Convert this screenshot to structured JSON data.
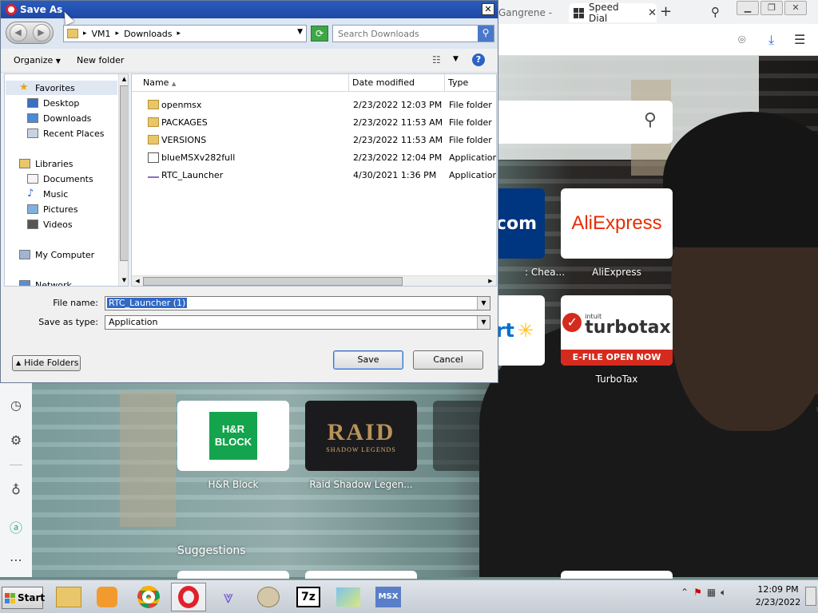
{
  "browser": {
    "tabs": [
      {
        "label": "Gangrene -"
      },
      {
        "label": "Speed Dial"
      }
    ],
    "speed_dial": {
      "tiles": [
        {
          "label": ": Chea...",
          "logo": ".com"
        },
        {
          "label": "AliExpress",
          "logo": "AliExpress"
        },
        {
          "label": "",
          "logo": "rt"
        },
        {
          "label": "TurboTax",
          "logo_top": "turbotax",
          "logo_small": "intuit",
          "logo_bottom": "E-FILE OPEN NOW"
        },
        {
          "label": "H&R Block",
          "logo": "H&R BLOCK"
        },
        {
          "label": "Raid Shadow Legen...",
          "logo": "RAID",
          "logo_sub": "SHADOW LEGENDS"
        }
      ],
      "suggestions_heading": "Suggestions"
    }
  },
  "dialog": {
    "title": "Save As",
    "breadcrumb": [
      "VM1",
      "Downloads"
    ],
    "search_placeholder": "Search Downloads",
    "toolbar": {
      "organize": "Organize",
      "new_folder": "New folder"
    },
    "nav_tree": [
      {
        "label": "Favorites",
        "icon": "star-icon"
      },
      {
        "label": "Desktop",
        "icon": "desktop-icon"
      },
      {
        "label": "Downloads",
        "icon": "downloads-icon"
      },
      {
        "label": "Recent Places",
        "icon": "recent-places-icon"
      },
      {
        "label": "Libraries",
        "icon": "libraries-icon"
      },
      {
        "label": "Documents",
        "icon": "documents-icon"
      },
      {
        "label": "Music",
        "icon": "music-icon"
      },
      {
        "label": "Pictures",
        "icon": "pictures-icon"
      },
      {
        "label": "Videos",
        "icon": "videos-icon"
      },
      {
        "label": "My Computer",
        "icon": "computer-icon"
      },
      {
        "label": "Network",
        "icon": "network-icon"
      }
    ],
    "columns": {
      "name": "Name",
      "date": "Date modified",
      "type": "Type"
    },
    "files": [
      {
        "name": "openmsx",
        "date": "2/23/2022 12:03 PM",
        "type": "File folder",
        "icon": "folder-icon"
      },
      {
        "name": "PACKAGES",
        "date": "2/23/2022 11:53 AM",
        "type": "File folder",
        "icon": "folder-icon"
      },
      {
        "name": "VERSIONS",
        "date": "2/23/2022 11:53 AM",
        "type": "File folder",
        "icon": "folder-icon"
      },
      {
        "name": "blueMSXv282full",
        "date": "2/23/2022 12:04 PM",
        "type": "Application",
        "icon": "application-icon"
      },
      {
        "name": "RTC_Launcher",
        "date": "4/30/2021 1:36 PM",
        "type": "Application",
        "icon": "rtc-launcher-icon"
      }
    ],
    "file_name_label": "File name:",
    "file_name_value": "RTC_Launcher (1)",
    "save_type_label": "Save as type:",
    "save_type_value": "Application",
    "hide_folders": "Hide Folders",
    "save": "Save",
    "cancel": "Cancel"
  },
  "taskbar": {
    "start": "Start",
    "time": "12:09 PM",
    "date": "2/23/2022",
    "apps": [
      "explorer-icon",
      "media-icon",
      "chrome-icon",
      "opera-icon",
      "app-icon",
      "paint-icon",
      "7zip-icon",
      "windows-icon",
      "msx-icon"
    ],
    "app_labels": {
      "sevenzip": "7z",
      "msx": "MSX"
    }
  }
}
